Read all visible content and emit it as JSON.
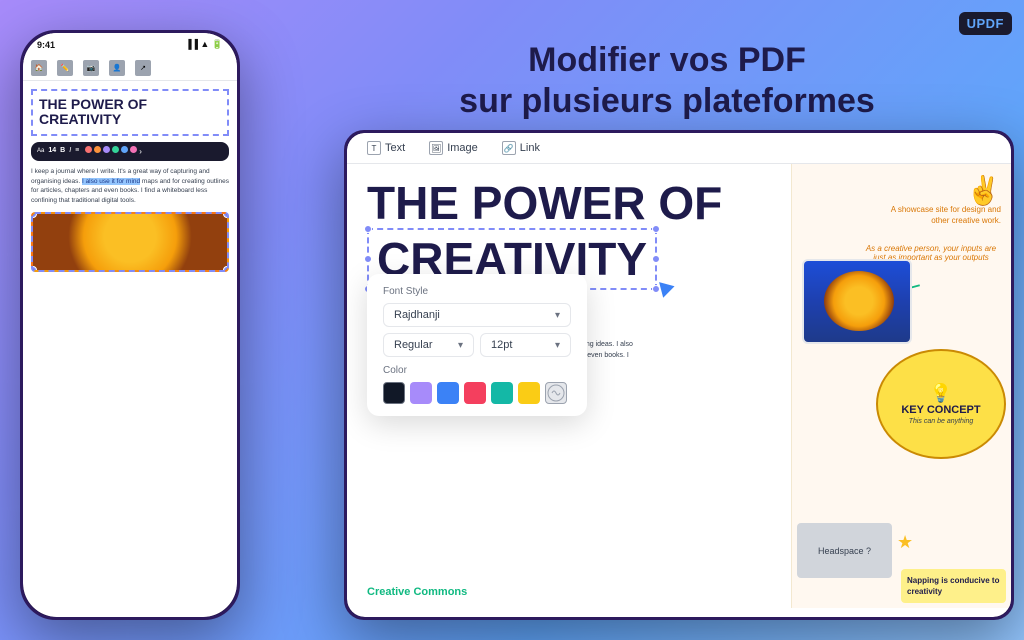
{
  "app": {
    "logo": "UPDF",
    "logo_accent": "UP"
  },
  "headline": {
    "line1": "Modifier vos PDF",
    "line2": "sur plusieurs plateformes"
  },
  "phone": {
    "status_time": "9:41",
    "title_line1": "THE POWER OF",
    "title_line2": "CREATIVITY",
    "paragraph": "I keep a journal where I write. It's a great way of capturing and organising ideas. I also use it for mind maps and for creating outlines for articles, chapters and even books. I find a whiteboard less confining that traditional digital tools."
  },
  "tablet": {
    "toolbar": {
      "text_label": "Text",
      "image_label": "Image",
      "link_label": "Link"
    },
    "title_line1": "THE POWER OF",
    "title_line2": "CREATIVITY",
    "font_popup": {
      "label": "Font Style",
      "font_name": "Rajdhanji",
      "style": "Regular",
      "size": "12pt",
      "color_label": "Color"
    },
    "right_panel": {
      "hand_emoji": "✌️",
      "showcase_text": "A showcase site for design and other creative work.",
      "creative_quote": "As a creative person, your inputs are just as important as your outputs",
      "key_concept_title": "KEY CONCEPT",
      "key_concept_sub": "This can be anything",
      "headspace_label": "Headspace ?",
      "napping_text": "Napping is conducive to creativity",
      "creative_commons": "Creative Commons"
    }
  }
}
